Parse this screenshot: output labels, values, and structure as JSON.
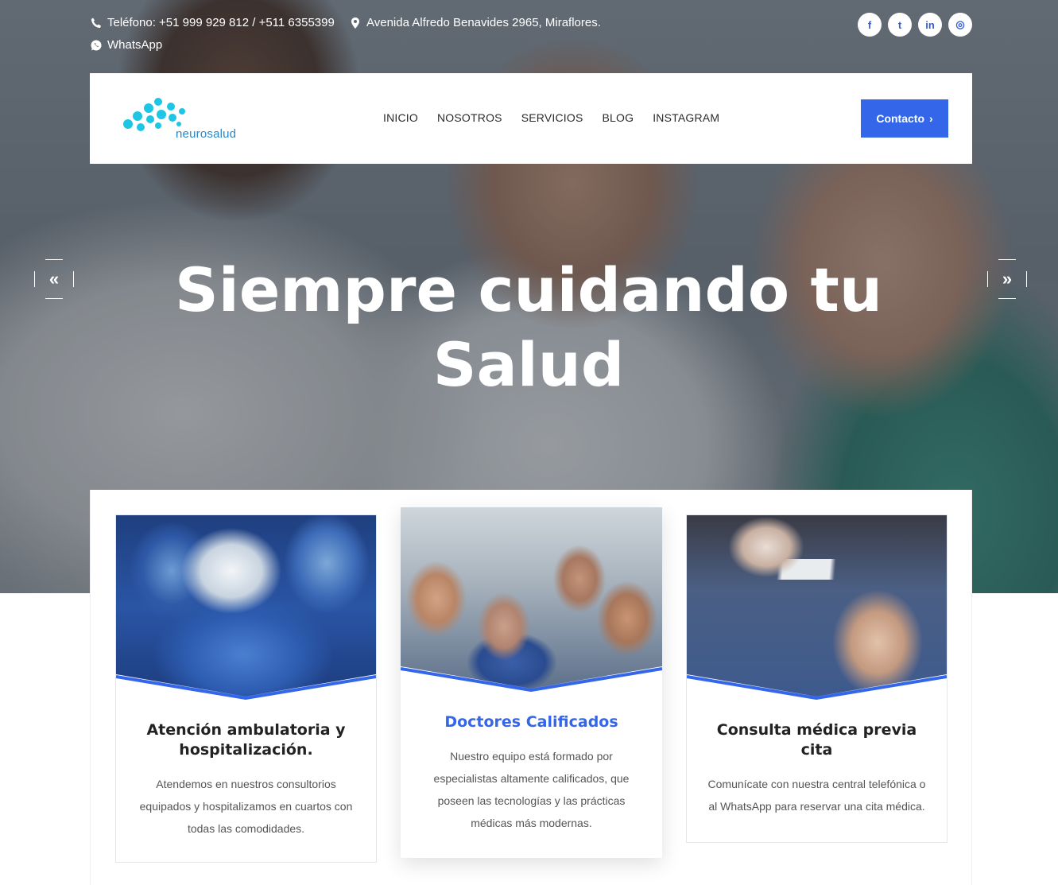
{
  "topbar": {
    "phone": "Teléfono: +51 999 929 812 / +511 6355399",
    "address": "Avenida Alfredo Benavides 2965, Miraflores.",
    "whatsapp": "WhatsApp",
    "social": [
      {
        "icon": "facebook-icon",
        "glyph": "f"
      },
      {
        "icon": "twitter-icon",
        "glyph": "t"
      },
      {
        "icon": "linkedin-icon",
        "glyph": "in"
      },
      {
        "icon": "instagram-icon",
        "glyph": "◎"
      }
    ]
  },
  "nav": {
    "logo_text": "neurosalud",
    "items": [
      "INICIO",
      "NOSOTROS",
      "SERVICIOS",
      "BLOG",
      "INSTAGRAM"
    ],
    "contact_label": "Contacto",
    "contact_arrow": "›"
  },
  "hero": {
    "title": "Siempre cuidando tu Salud",
    "prev_glyph": "«",
    "next_glyph": "»"
  },
  "features": [
    {
      "title": "Atención ambulatoria y hospitalización.",
      "text": "Atendemos en nuestros consultorios equipados y hospitalizamos en cuartos con todas las comodidades."
    },
    {
      "title": "Doctores Calificados",
      "text": "Nuestro equipo está formado por especialistas altamente calificados, que poseen las tecnologías y las prácticas médicas más modernas."
    },
    {
      "title": "Consulta médica previa cita",
      "text": "Comunícate con nuestra central telefónica o al WhatsApp para reservar una cita médica."
    }
  ],
  "colors": {
    "accent": "#3366e8",
    "logo": "#1ec6e6"
  }
}
